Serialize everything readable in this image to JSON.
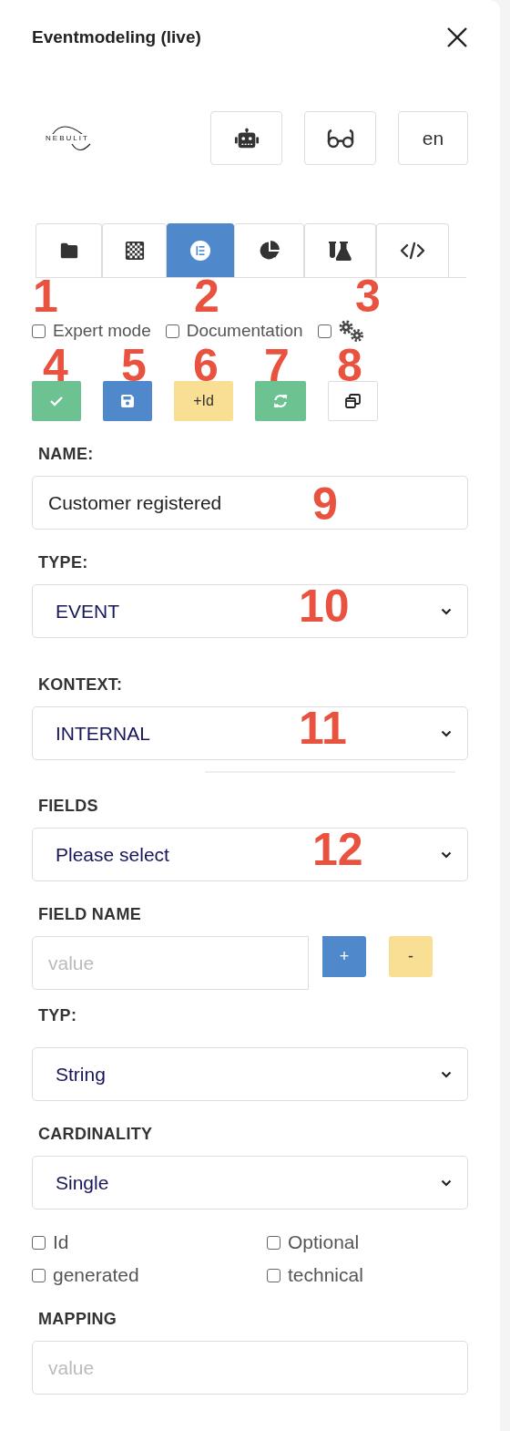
{
  "panel": {
    "title": "Eventmodeling (live)"
  },
  "logo": {
    "text": "NEBULIT"
  },
  "header_buttons": [
    {
      "kind": "robot"
    },
    {
      "kind": "glasses"
    },
    {
      "kind": "text",
      "label": "en"
    }
  ],
  "tabs": [
    {
      "selected": false
    },
    {
      "selected": false
    },
    {
      "selected": true
    },
    {
      "selected": false
    },
    {
      "selected": false
    },
    {
      "selected": false
    }
  ],
  "options": [
    {
      "kind": "text",
      "label": "Expert mode",
      "checked": false
    },
    {
      "kind": "text",
      "label": "Documentation",
      "checked": false
    },
    {
      "kind": "gears",
      "checked": false
    }
  ],
  "actions": [
    {
      "kind": "check"
    },
    {
      "kind": "save"
    },
    {
      "kind": "text",
      "label": "+Id"
    },
    {
      "kind": "sync"
    },
    {
      "kind": "windows"
    }
  ],
  "form": [
    {
      "kind": "input",
      "label": "NAME:",
      "value": "Customer registered"
    },
    {
      "kind": "select",
      "label": "TYPE:",
      "value": "EVENT"
    },
    {
      "kind": "select",
      "label": "KONTEXT:",
      "value": "INTERNAL"
    },
    {
      "kind": "divider"
    },
    {
      "kind": "select",
      "label": "FIELDS",
      "value": "Please select"
    },
    {
      "kind": "input_buttons",
      "label": "FIELD NAME",
      "placeholder": "value",
      "buttons": [
        "+",
        "-"
      ]
    },
    {
      "kind": "select",
      "label": "TYP:",
      "value": "String"
    },
    {
      "kind": "select",
      "label": "CARDINALITY",
      "value": "Single"
    },
    {
      "kind": "checks",
      "items": [
        {
          "label": "Id",
          "checked": false
        },
        {
          "label": "Optional",
          "checked": false
        },
        {
          "label": "generated",
          "checked": false
        },
        {
          "label": "technical",
          "checked": false
        }
      ]
    },
    {
      "kind": "input",
      "label": "MAPPING",
      "placeholder": "value"
    }
  ],
  "annotations": [
    {
      "label": "1"
    },
    {
      "label": "2"
    },
    {
      "label": "3"
    },
    {
      "label": "4"
    },
    {
      "label": "5"
    },
    {
      "label": "6"
    },
    {
      "label": "7"
    },
    {
      "label": "8"
    },
    {
      "label": "9"
    },
    {
      "label": "10"
    },
    {
      "label": "11"
    },
    {
      "label": "12"
    }
  ]
}
